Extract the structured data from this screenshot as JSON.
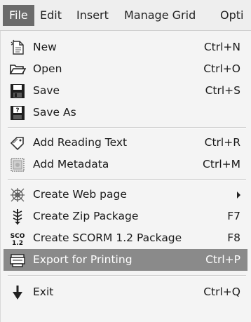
{
  "menubar": {
    "items": [
      {
        "label": "File"
      },
      {
        "label": "Edit"
      },
      {
        "label": "Insert"
      },
      {
        "label": "Manage Grid"
      },
      {
        "label": "Opti"
      }
    ]
  },
  "file_menu": {
    "items": [
      {
        "label": "New",
        "shortcut": "Ctrl+N",
        "icon": "new-document-icon"
      },
      {
        "label": "Open",
        "shortcut": "Ctrl+O",
        "icon": "open-folder-icon"
      },
      {
        "label": "Save",
        "shortcut": "Ctrl+S",
        "icon": "floppy-disk-icon"
      },
      {
        "label": "Save As",
        "shortcut": "",
        "icon": "floppy-disk-question-icon"
      },
      {
        "label": "Add Reading Text",
        "shortcut": "Ctrl+R",
        "icon": "tag-icon"
      },
      {
        "label": "Add Metadata",
        "shortcut": "Ctrl+M",
        "icon": "metadata-icon"
      },
      {
        "label": "Create Web page",
        "shortcut": "",
        "icon": "web-page-icon"
      },
      {
        "label": "Create Zip Package",
        "shortcut": "F7",
        "icon": "zip-package-icon"
      },
      {
        "label": "Create SCORM 1.2 Package",
        "shortcut": "F8",
        "icon": "scorm-package-icon",
        "icon_text": "SCO\n1.2"
      },
      {
        "label": "Export for Printing",
        "shortcut": "Ctrl+P",
        "icon": "printer-icon"
      },
      {
        "label": "Exit",
        "shortcut": "Ctrl+Q",
        "icon": "exit-arrow-icon"
      }
    ]
  },
  "colors": {
    "highlight": "#8a8a8a",
    "active_menubar": "#6b6b6b"
  }
}
